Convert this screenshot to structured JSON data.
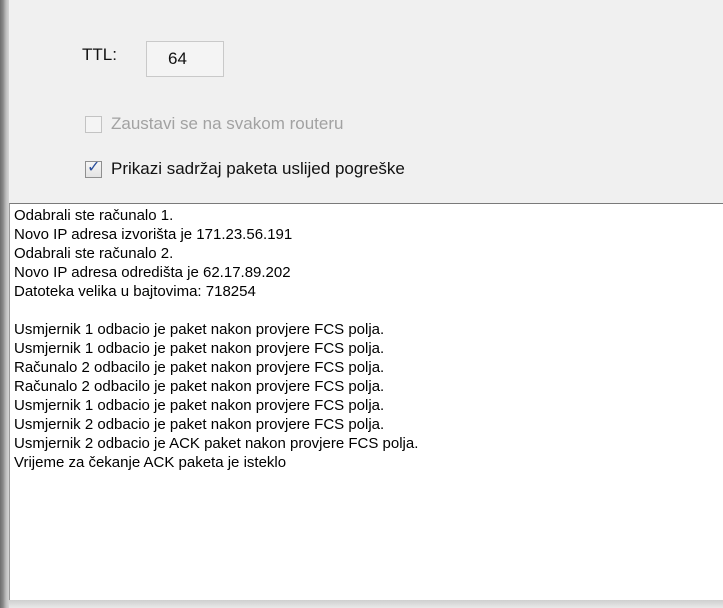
{
  "settings": {
    "ttl_label": "TTL:",
    "ttl_value": "64",
    "stop_at_router": {
      "label": "Zaustavi se na svakom routeru",
      "checked": false,
      "enabled": false
    },
    "show_packet_on_error": {
      "label": "Prikazi sadržaj paketa uslijed pogreške",
      "checked": true,
      "enabled": true
    }
  },
  "log": {
    "lines": [
      "Odabrali ste računalo 1.",
      "Novo IP adresa izvorišta je 171.23.56.191",
      "Odabrali ste računalo 2.",
      "Novo IP adresa odredišta je 62.17.89.202",
      "Datoteka velika u bajtovima: 718254",
      "",
      "Usmjernik 1 odbacio je paket nakon provjere FCS polja.",
      "Usmjernik 1 odbacio je paket nakon provjere FCS polja.",
      "Računalo 2 odbacilo je paket nakon provjere FCS polja.",
      "Računalo 2 odbacilo je paket nakon provjere FCS polja.",
      "Usmjernik 1 odbacio je paket nakon provjere FCS polja.",
      "Usmjernik 2 odbacio je paket nakon provjere FCS polja.",
      "Usmjernik 2 odbacio je ACK paket nakon provjere FCS polja.",
      "Vrijeme za čekanje ACK paketa je isteklo"
    ]
  },
  "colors": {
    "panel_bg": "#f0f0f0",
    "log_bg": "#ffffff",
    "check_tick": "#2a4f9c",
    "disabled_text": "#a2a2a2"
  }
}
